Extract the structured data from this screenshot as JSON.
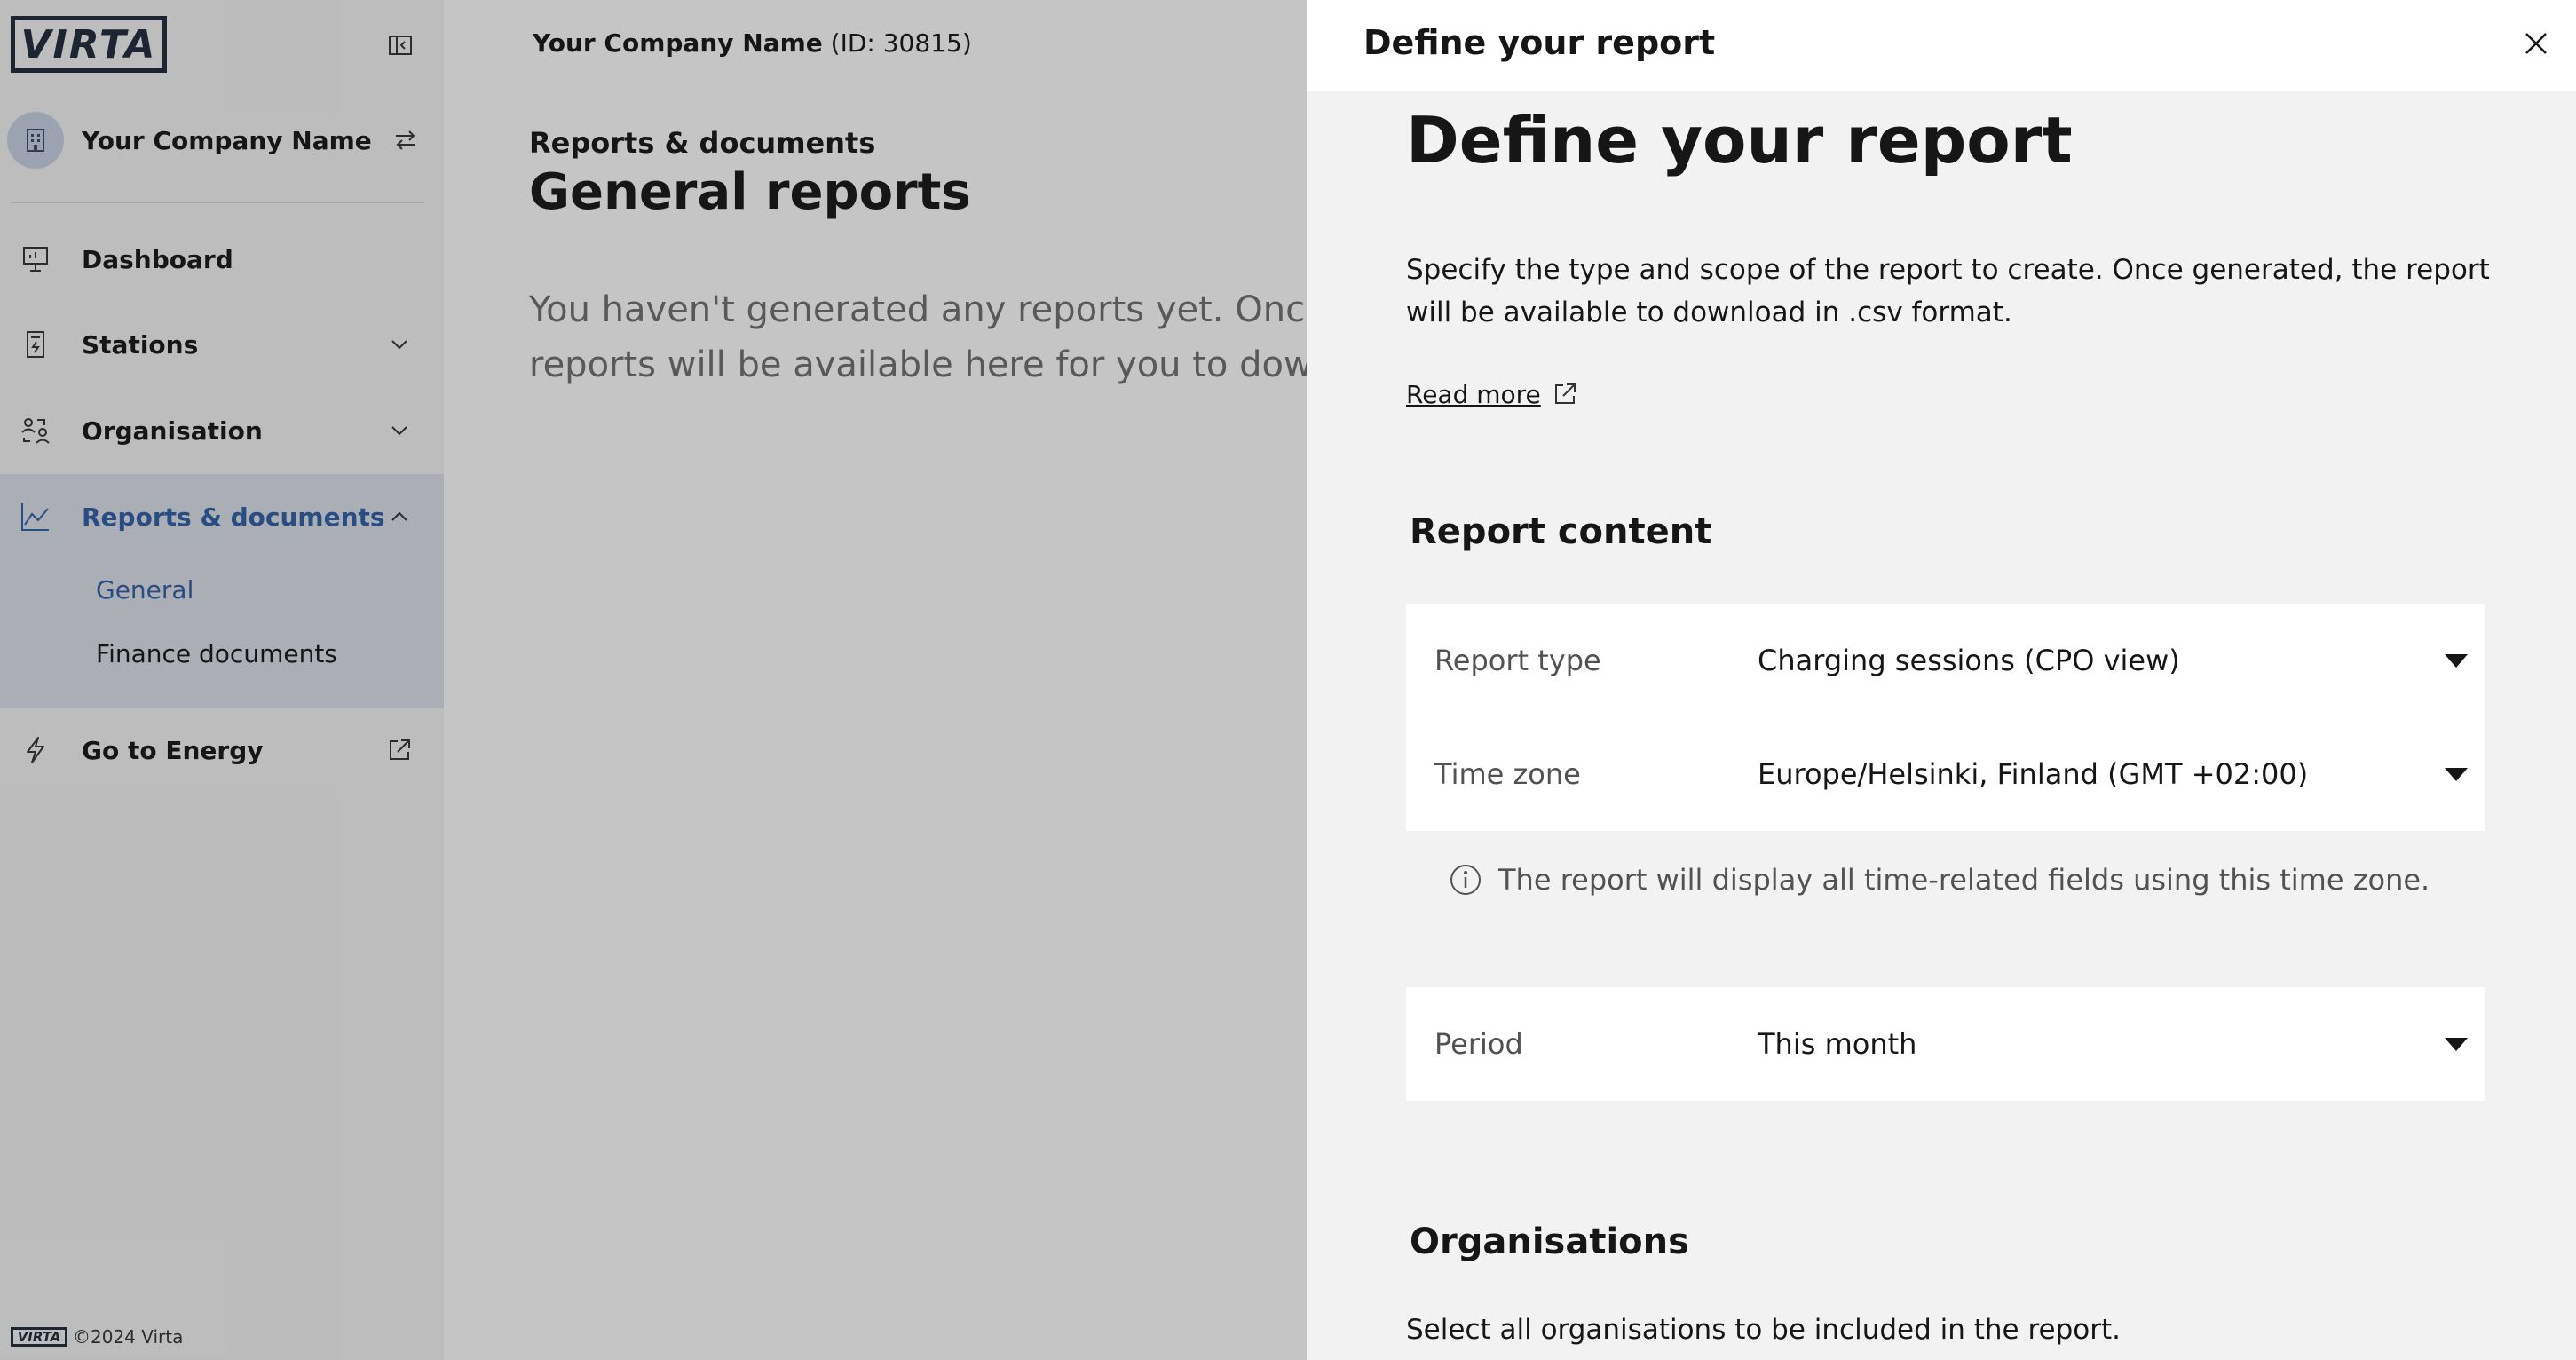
{
  "sidebar": {
    "logo_text": "VIRTA",
    "company_name": "Your Company Name",
    "nav": {
      "dashboard": "Dashboard",
      "stations": "Stations",
      "organisation": "Organisation",
      "reports": "Reports & documents",
      "reports_sub": [
        "General",
        "Finance documents"
      ],
      "energy": "Go to Energy"
    },
    "footer_logo": "VIRTA",
    "footer_text": "©2024 Virta"
  },
  "main": {
    "topbar_company": "Your Company Name",
    "topbar_id": " (ID: 30815)",
    "breadcrumb": "Reports & documents",
    "title": "General reports",
    "empty_message": "You haven't generated any reports yet. Once generated, reports will be available here for you to download."
  },
  "drawer": {
    "header_title": "Define your report",
    "title": "Define your report",
    "intro": "Specify the type and scope of the report to create. Once generated, the report will be available to download in .csv format.",
    "read_more": "Read more",
    "report_content_title": "Report content",
    "fields": {
      "report_type_label": "Report type",
      "report_type_value": "Charging sessions (CPO view)",
      "time_zone_label": "Time zone",
      "time_zone_value": "Europe/Helsinki, Finland (GMT +02:00)",
      "period_label": "Period",
      "period_value": "This month"
    },
    "time_zone_hint": "The report will display all time-related fields using this time zone.",
    "organisations_title": "Organisations",
    "organisations_desc": "Select all organisations to be included in the report."
  },
  "colors": {
    "accent": "#2d5fa9",
    "logo": "#1f2a3c",
    "active_bg": "#dde1e8",
    "drawer_bg": "#f2f2f2"
  },
  "icons": [
    "collapse-sidebar-icon",
    "building-icon",
    "swap-icon",
    "dashboard-icon",
    "station-icon",
    "organisation-icon",
    "chart-icon",
    "bolt-icon",
    "external-link-icon",
    "chevron-down-icon",
    "chevron-up-icon",
    "close-icon",
    "info-icon",
    "caret-down-icon"
  ]
}
